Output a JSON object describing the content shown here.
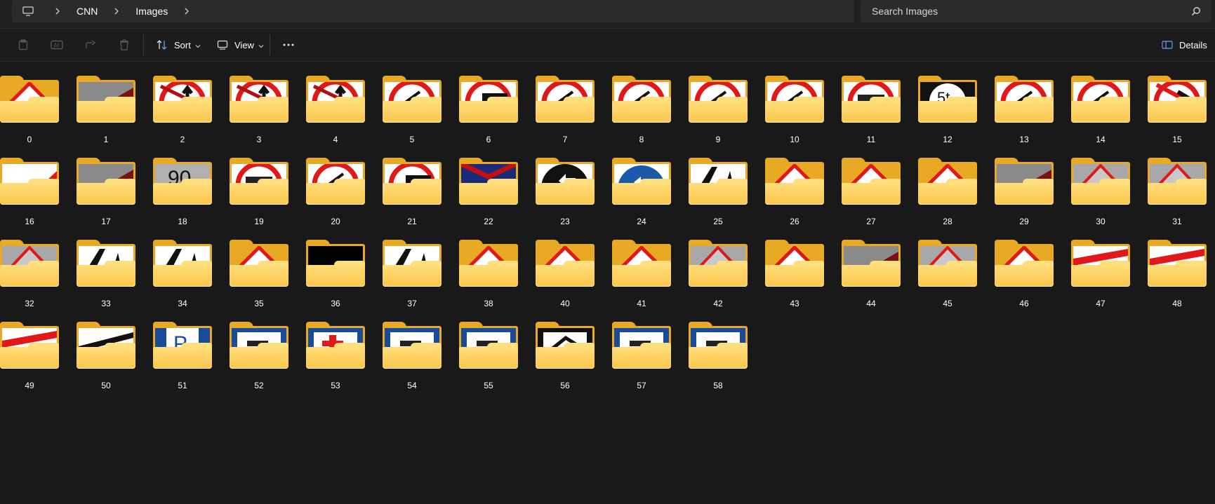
{
  "address_bar": {
    "breadcrumbs": [
      "CNN",
      "Images"
    ],
    "icons": {
      "root": "computer-icon",
      "separator": "chevron-right-icon"
    }
  },
  "search": {
    "placeholder": "Search Images"
  },
  "toolbar": {
    "sort_label": "Sort",
    "view_label": "View",
    "details_label": "Details",
    "icons": [
      "clipboard-icon",
      "rename-icon",
      "share-icon",
      "delete-icon",
      "sort-icon",
      "view-icon",
      "more-icon",
      "details-pane-icon"
    ]
  },
  "folders": [
    {
      "name": "0",
      "thumb": "warn"
    },
    {
      "name": "1",
      "thumb": "grey-red"
    },
    {
      "name": "2",
      "thumb": "no-overtake"
    },
    {
      "name": "3",
      "thumb": "no-overtake"
    },
    {
      "name": "4",
      "thumb": "no-overtake"
    },
    {
      "name": "5",
      "thumb": "ring"
    },
    {
      "name": "6",
      "thumb": "ring-black"
    },
    {
      "name": "7",
      "thumb": "ring"
    },
    {
      "name": "8",
      "thumb": "ring"
    },
    {
      "name": "9",
      "thumb": "ring"
    },
    {
      "name": "10",
      "thumb": "ring"
    },
    {
      "name": "11",
      "thumb": "ring-text"
    },
    {
      "name": "12",
      "thumb": "black-white"
    },
    {
      "name": "13",
      "thumb": "ring"
    },
    {
      "name": "14",
      "thumb": "ring"
    },
    {
      "name": "15",
      "thumb": "ring-diag"
    },
    {
      "name": "16",
      "thumb": "white-red"
    },
    {
      "name": "17",
      "thumb": "grey-red"
    },
    {
      "name": "18",
      "thumb": "grey-num"
    },
    {
      "name": "19",
      "thumb": "ring-text"
    },
    {
      "name": "20",
      "thumb": "ring"
    },
    {
      "name": "21",
      "thumb": "ring-black"
    },
    {
      "name": "22",
      "thumb": "navy-red"
    },
    {
      "name": "23",
      "thumb": "black-arrow"
    },
    {
      "name": "24",
      "thumb": "blue-circle"
    },
    {
      "name": "25",
      "thumb": "warn-black"
    },
    {
      "name": "26",
      "thumb": "warn"
    },
    {
      "name": "27",
      "thumb": "warn"
    },
    {
      "name": "28",
      "thumb": "warn"
    },
    {
      "name": "29",
      "thumb": "grey-red"
    },
    {
      "name": "30",
      "thumb": "grey-warn"
    },
    {
      "name": "31",
      "thumb": "grey-warn"
    },
    {
      "name": "32",
      "thumb": "grey-warn"
    },
    {
      "name": "33",
      "thumb": "warn-black"
    },
    {
      "name": "34",
      "thumb": "warn-black"
    },
    {
      "name": "35",
      "thumb": "warn"
    },
    {
      "name": "36",
      "thumb": "black"
    },
    {
      "name": "37",
      "thumb": "warn-black"
    },
    {
      "name": "38",
      "thumb": "warn"
    },
    {
      "name": "40",
      "thumb": "warn"
    },
    {
      "name": "41",
      "thumb": "warn"
    },
    {
      "name": "42",
      "thumb": "grey-warn"
    },
    {
      "name": "43",
      "thumb": "warn"
    },
    {
      "name": "44",
      "thumb": "grey-red"
    },
    {
      "name": "45",
      "thumb": "grey-warn"
    },
    {
      "name": "46",
      "thumb": "warn"
    },
    {
      "name": "47",
      "thumb": "red-stripe"
    },
    {
      "name": "48",
      "thumb": "red-stripe"
    },
    {
      "name": "49",
      "thumb": "red-stripe"
    },
    {
      "name": "50",
      "thumb": "black-stripe"
    },
    {
      "name": "51",
      "thumb": "blue-p"
    },
    {
      "name": "52",
      "thumb": "blue-sq"
    },
    {
      "name": "53",
      "thumb": "blue-cross"
    },
    {
      "name": "54",
      "thumb": "blue-sq"
    },
    {
      "name": "55",
      "thumb": "blue-sq"
    },
    {
      "name": "56",
      "thumb": "black-sq"
    },
    {
      "name": "57",
      "thumb": "blue-sq"
    },
    {
      "name": "58",
      "thumb": "blue-sq"
    }
  ]
}
